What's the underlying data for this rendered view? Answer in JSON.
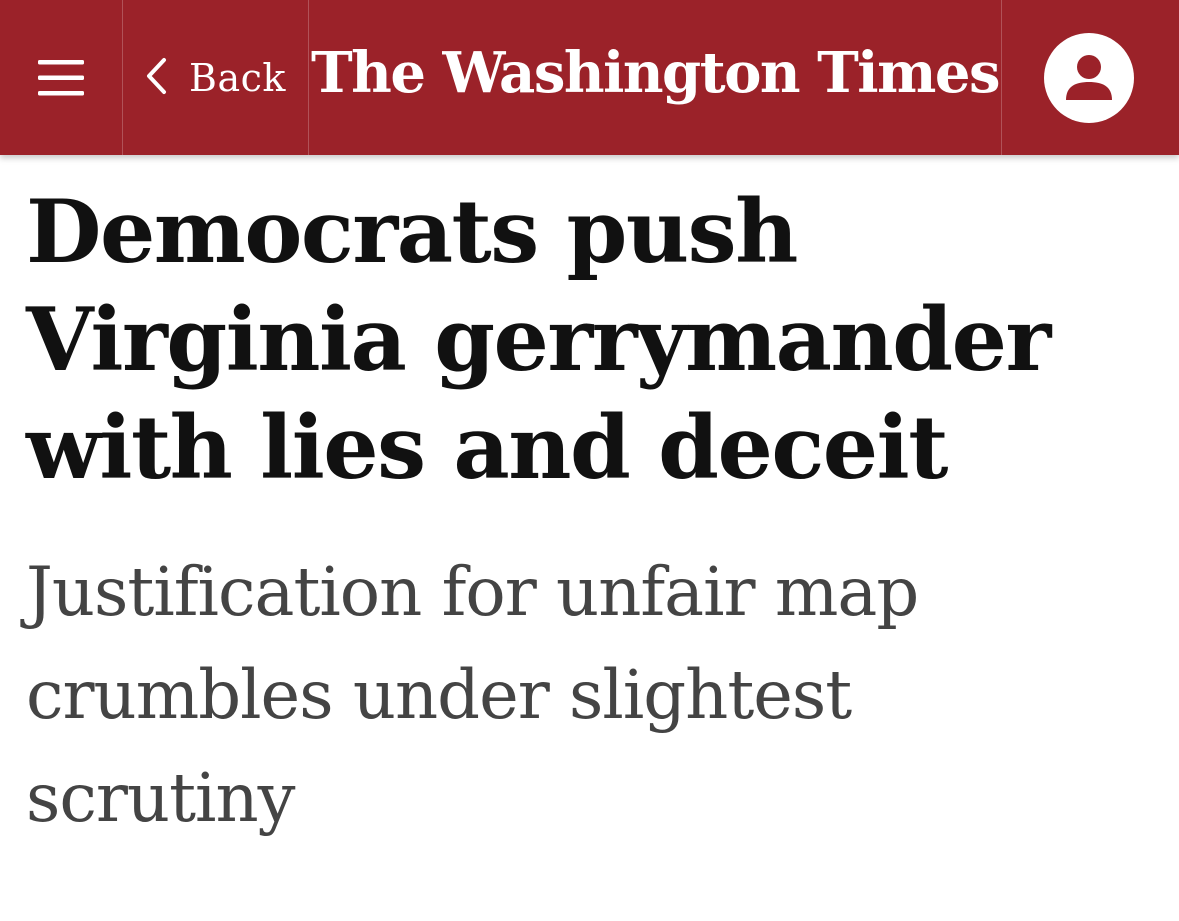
{
  "header": {
    "back_label": "Back",
    "logo_text": "The Washington Times",
    "bar_color": "#9b2229",
    "icons": {
      "menu": "hamburger-menu-icon",
      "back": "chevron-left-icon",
      "account": "user-account-icon"
    }
  },
  "article": {
    "headline": "Democrats push Virginia gerrymander with lies and deceit",
    "subheadline": "Justification for unfair map crumbles under slightest scrutiny"
  }
}
